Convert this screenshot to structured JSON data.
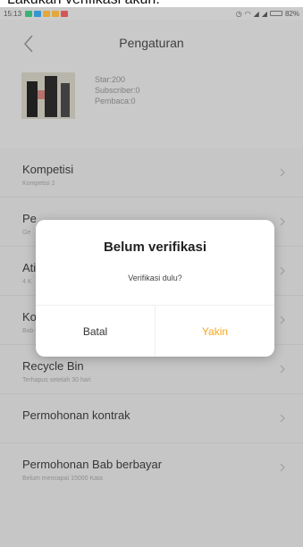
{
  "caption": "Lakukan verifikasi akun.",
  "status_bar": {
    "time": "15:13",
    "battery": "82%"
  },
  "header": {
    "title": "Pengaturan"
  },
  "profile": {
    "stats": [
      "Star:200",
      "Subscriber:0",
      "Pembaca:0"
    ]
  },
  "menu": {
    "items": [
      {
        "label": "Kompetisi",
        "sub": "Kompetisi 2"
      },
      {
        "label": "Pe",
        "sub": "Ge"
      },
      {
        "label": "Ati",
        "sub": "4 K"
      },
      {
        "label": "Ko",
        "sub": "Bab 0"
      },
      {
        "label": "Recycle Bin",
        "sub": "Terhapus setelah 30 hari"
      },
      {
        "label": "Permohonan kontrak",
        "sub": ""
      },
      {
        "label": "Permohonan Bab berbayar",
        "sub": "Belum mencapai 15000 Kata"
      }
    ]
  },
  "dialog": {
    "title": "Belum verifikasi",
    "message": "Verifikasi dulu?",
    "cancel_label": "Batal",
    "confirm_label": "Yakin"
  },
  "colors": {
    "accent": "#f7a81b",
    "background_dim": "#d3d3d3"
  }
}
